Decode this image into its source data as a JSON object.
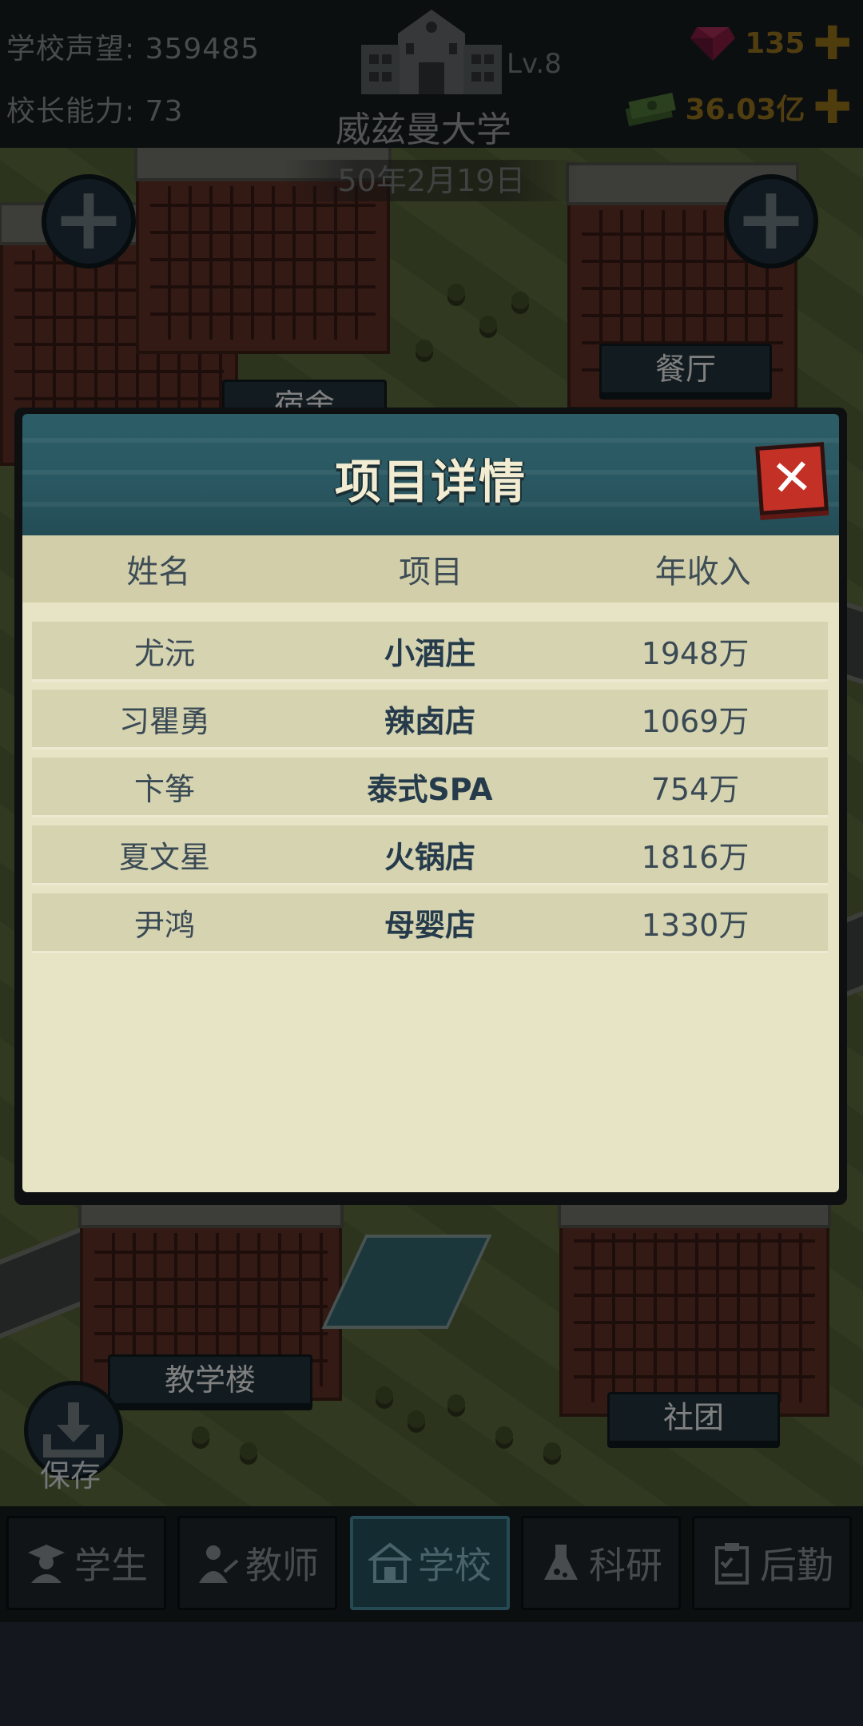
{
  "header": {
    "reputation_label": "学校声望:",
    "reputation_value": "359485",
    "ability_label": "校长能力:",
    "ability_value": "73",
    "level": "Lv.8",
    "school_name": "威兹曼大学",
    "gems": "135",
    "money": "36.03亿",
    "date": "50年2月19日"
  },
  "map": {
    "labels": {
      "dorm": "宿舍",
      "canteen": "餐厅",
      "teaching": "教学楼",
      "club": "社团"
    }
  },
  "modal": {
    "title": "项目详情",
    "columns": [
      "姓名",
      "项目",
      "年收入"
    ],
    "rows": [
      {
        "name": "尤沅",
        "project": "小酒庄",
        "income": "1948万"
      },
      {
        "name": "习瞿勇",
        "project": "辣卤店",
        "income": "1069万"
      },
      {
        "name": "卞筝",
        "project": "泰式SPA",
        "income": "754万"
      },
      {
        "name": "夏文星",
        "project": "火锅店",
        "income": "1816万"
      },
      {
        "name": "尹鸿",
        "project": "母婴店",
        "income": "1330万"
      }
    ]
  },
  "save_label": "保存",
  "nav": [
    {
      "label": "学生",
      "icon": "student-icon"
    },
    {
      "label": "教师",
      "icon": "teacher-icon"
    },
    {
      "label": "学校",
      "icon": "school-icon"
    },
    {
      "label": "科研",
      "icon": "flask-icon"
    },
    {
      "label": "后勤",
      "icon": "clipboard-icon"
    }
  ],
  "colors": {
    "accent_tab": "#244a57",
    "close_red": "#c23026",
    "panel_bg": "#e6e4c4"
  }
}
